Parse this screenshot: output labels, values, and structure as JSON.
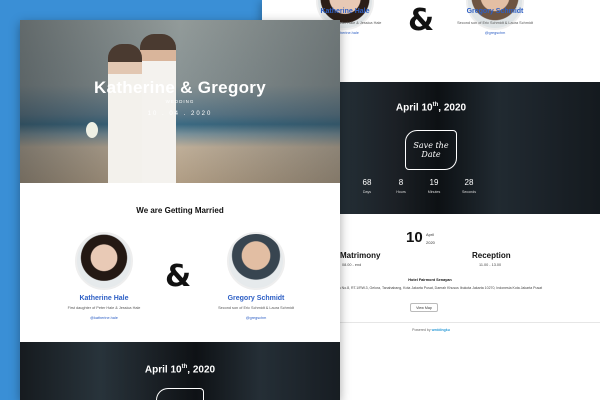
{
  "back": {
    "bride_name": "Katherine Hale",
    "bride_parents": "First daughter of Peter Hale & Jessica Hale",
    "bride_ig": "@katherine.hale",
    "groom_name": "Gregory Schmidt",
    "groom_parents": "Second son of Eric Schmidt & Laura Schmidt",
    "groom_ig": "@gregschm",
    "ampersand": "&",
    "date_main": "April 10",
    "date_sup": "th",
    "date_year": ", 2020",
    "save_the_date": "Save the Date",
    "countdown": [
      {
        "value": "68",
        "label": "Days"
      },
      {
        "value": "8",
        "label": "Hours"
      },
      {
        "value": "19",
        "label": "Minutes"
      },
      {
        "value": "28",
        "label": "Seconds"
      }
    ],
    "day": "10",
    "month": "April",
    "year": "2020",
    "matrimony_label": "Matrimony",
    "matrimony_time": "08.00 - end",
    "reception_label": "Reception",
    "reception_time": "11.00 - 13.00",
    "venue": "Hotel Fairmont Senayan",
    "address": "Jl. Asia Afrika No.8, RT.1/RW.3, Gelora, Tanahabang, Kota Jakarta Pusat, Daerah Khusus Ibukota Jakarta 10270, Indonesia Kota Jakarta Pusat",
    "map_button": "View Map",
    "footer_prefix": "Powered by",
    "footer_brand": "weddingku"
  },
  "front": {
    "hero_title": "Katherine & Gregory",
    "hero_sub": "WEDDING",
    "hero_date": "10 . 04 . 2020",
    "section_title": "We are Getting Married",
    "ampersand": "&",
    "bride_name": "Katherine Hale",
    "bride_parents": "First daughter of Peter Hale & Jessica Hale",
    "bride_ig": "@katherine.hale",
    "groom_name": "Gregory Schmidt",
    "groom_parents": "Second son of Eric Schmidt & Laura Schmidt",
    "groom_ig": "@gregschm",
    "date_main": "April 10",
    "date_sup": "th",
    "date_year": ", 2020"
  },
  "colors": {
    "background": "#3a8fd6",
    "accent": "#2d5fc5"
  }
}
